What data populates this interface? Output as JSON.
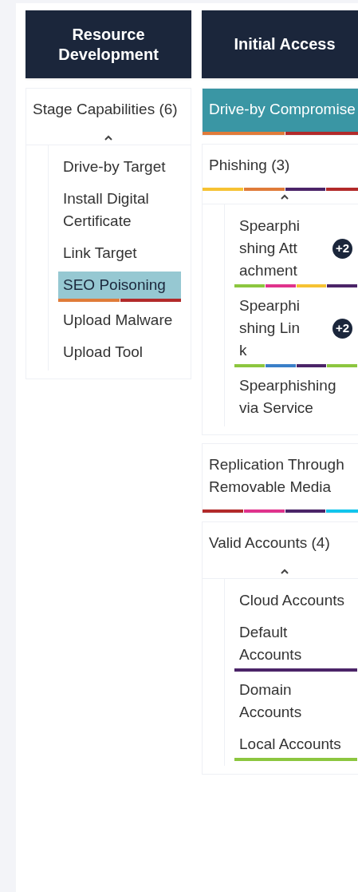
{
  "tactics": [
    {
      "title": "Resource Development",
      "techniques": [
        {
          "name": "Stage Capabilities (6)",
          "selected": false,
          "expanded": true,
          "subtechniques": [
            {
              "name": "Drive-by Target",
              "selected": false
            },
            {
              "name": "Install Digital Certificate",
              "selected": false
            },
            {
              "name": "Link Target",
              "selected": false
            },
            {
              "name": "SEO Poisoning",
              "selected": true,
              "tags": [
                {
                  "color": "#e07b39"
                },
                {
                  "color": "#b22a2a"
                }
              ]
            },
            {
              "name": "Upload Malware",
              "selected": false
            },
            {
              "name": "Upload Tool",
              "selected": false
            }
          ]
        }
      ]
    },
    {
      "title": "Initial Access",
      "techniques": [
        {
          "name": "Drive-by Compromise",
          "selected": true,
          "tags": [
            {
              "color": "#e07b39"
            },
            {
              "color": "#b22a2a"
            }
          ],
          "expanded": false
        },
        {
          "name": "Phishing (3)",
          "selected": false,
          "tags": [
            {
              "color": "#f6c233"
            },
            {
              "color": "#e07b39"
            },
            {
              "color": "#4b2468"
            },
            {
              "color": "#b22a2a"
            }
          ],
          "expanded": true,
          "subtechniques": [
            {
              "name": "Spearphishing Attachment",
              "selected": false,
              "badge": "+2",
              "tags": [
                {
                  "color": "#8cc63f"
                },
                {
                  "color": "#e0338c"
                },
                {
                  "color": "#f6c233"
                },
                {
                  "color": "#4b2468"
                }
              ]
            },
            {
              "name": "Spearphishing Link",
              "selected": false,
              "badge": "+2",
              "tags": [
                {
                  "color": "#8cc63f"
                },
                {
                  "color": "#3a7fc8"
                },
                {
                  "color": "#4b2468"
                },
                {
                  "color": "#8cc63f"
                }
              ]
            },
            {
              "name": "Spearphishing via Service",
              "selected": false
            }
          ]
        },
        {
          "name": "Replication Through Removable Media",
          "selected": false,
          "tags": [
            {
              "color": "#b22a2a"
            },
            {
              "color": "#e0338c"
            },
            {
              "color": "#4b2468"
            },
            {
              "color": "#12c5ec"
            }
          ],
          "expanded": false
        },
        {
          "name": "Valid Accounts (4)",
          "selected": false,
          "expanded": true,
          "subtechniques": [
            {
              "name": "Cloud Accounts",
              "selected": false
            },
            {
              "name": "Default Accounts",
              "selected": false,
              "tags": [
                {
                  "color": "#4b2468"
                }
              ]
            },
            {
              "name": "Domain Accounts",
              "selected": false
            },
            {
              "name": "Local Accounts",
              "selected": false,
              "tags": [
                {
                  "color": "#8cc63f"
                }
              ]
            }
          ]
        }
      ]
    }
  ]
}
